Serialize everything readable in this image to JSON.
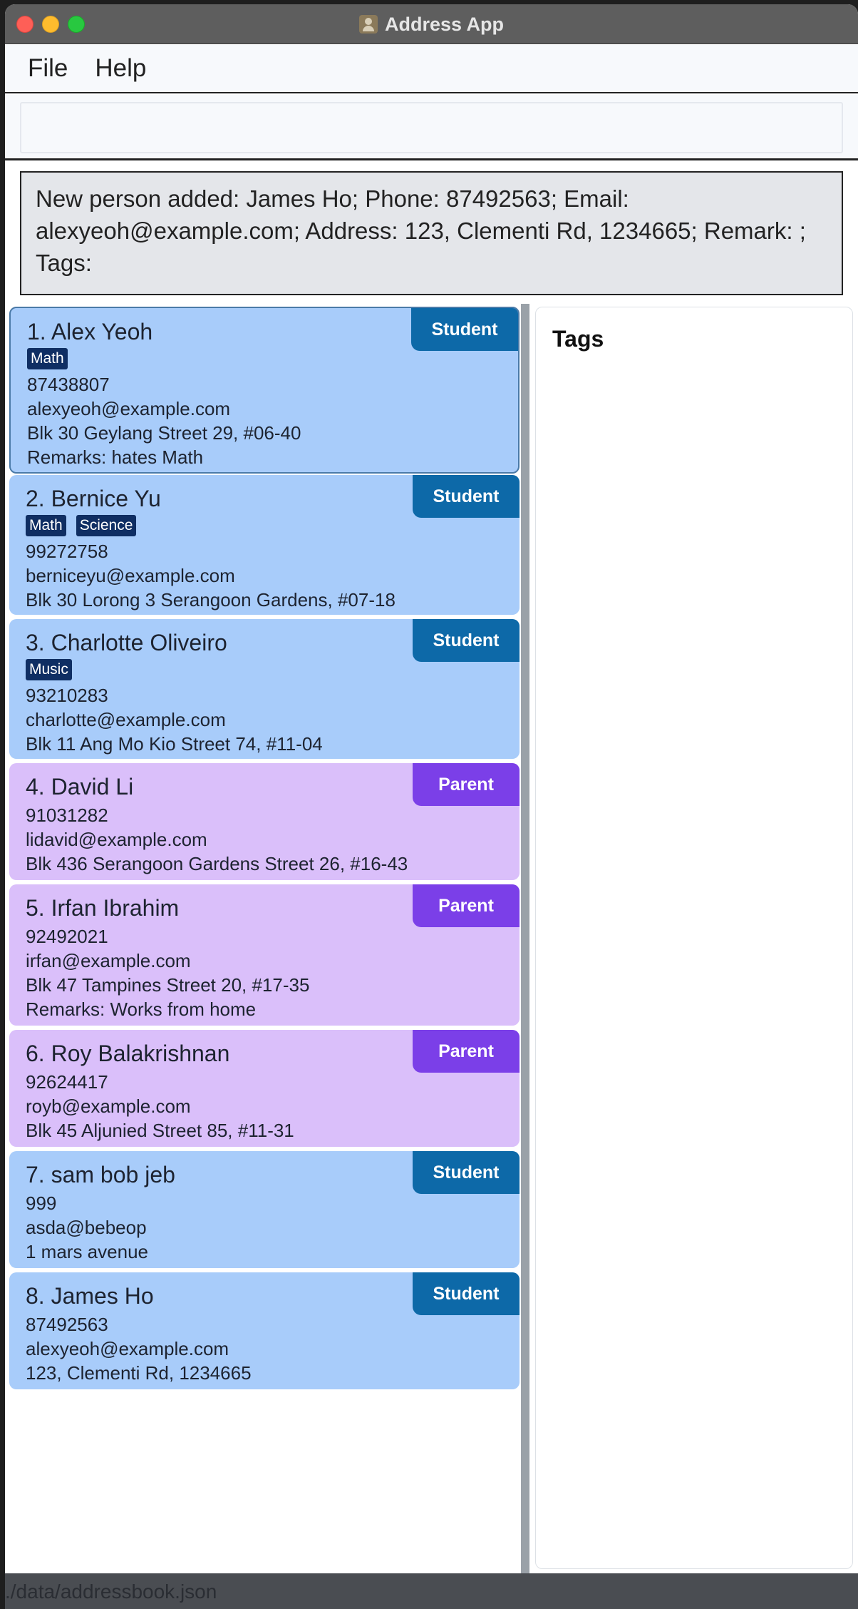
{
  "window": {
    "title": "Address App"
  },
  "menu": {
    "file": "File",
    "help": "Help"
  },
  "command": {
    "value": ""
  },
  "result": {
    "message": "New person added: James Ho; Phone: 87492563; Email: alexyeoh@example.com; Address: 123, Clementi Rd, 1234665; Remark: ; Tags:"
  },
  "persons": [
    {
      "name": "1. Alex Yeoh",
      "role": "Student",
      "tags": [
        "Math"
      ],
      "phone": "87438807",
      "email": "alexyeoh@example.com",
      "address": "Blk 30 Geylang Street 29, #06-40",
      "remark": "Remarks: hates Math"
    },
    {
      "name": "2. Bernice Yu",
      "role": "Student",
      "tags": [
        "Math",
        "Science"
      ],
      "phone": "99272758",
      "email": "berniceyu@example.com",
      "address": "Blk 30 Lorong 3 Serangoon Gardens, #07-18",
      "remark": ""
    },
    {
      "name": "3. Charlotte Oliveiro",
      "role": "Student",
      "tags": [
        "Music"
      ],
      "phone": "93210283",
      "email": "charlotte@example.com",
      "address": "Blk 11 Ang Mo Kio Street 74, #11-04",
      "remark": ""
    },
    {
      "name": "4. David Li",
      "role": "Parent",
      "tags": [],
      "phone": "91031282",
      "email": "lidavid@example.com",
      "address": "Blk 436 Serangoon Gardens Street 26, #16-43",
      "remark": ""
    },
    {
      "name": "5. Irfan Ibrahim",
      "role": "Parent",
      "tags": [],
      "phone": "92492021",
      "email": "irfan@example.com",
      "address": "Blk 47 Tampines Street 20, #17-35",
      "remark": "Remarks: Works from home"
    },
    {
      "name": "6. Roy Balakrishnan",
      "role": "Parent",
      "tags": [],
      "phone": "92624417",
      "email": "royb@example.com",
      "address": "Blk 45 Aljunied Street 85, #11-31",
      "remark": ""
    },
    {
      "name": "7. sam bob jeb",
      "role": "Student",
      "tags": [],
      "phone": "999",
      "email": "asda@bebeop",
      "address": "1 mars avenue",
      "remark": ""
    },
    {
      "name": "8. James Ho",
      "role": "Student",
      "tags": [],
      "phone": "87492563",
      "email": "alexyeoh@example.com",
      "address": "123, Clementi Rd, 1234665",
      "remark": ""
    }
  ],
  "tags_panel": {
    "title": "Tags"
  },
  "status": {
    "path": "./data/addressbook.json"
  },
  "colors": {
    "student_card": "#a8ccfa",
    "parent_card": "#dabffa",
    "student_badge": "#0d69a8",
    "parent_badge": "#7b3fe8",
    "tag": "#0f2e63"
  }
}
